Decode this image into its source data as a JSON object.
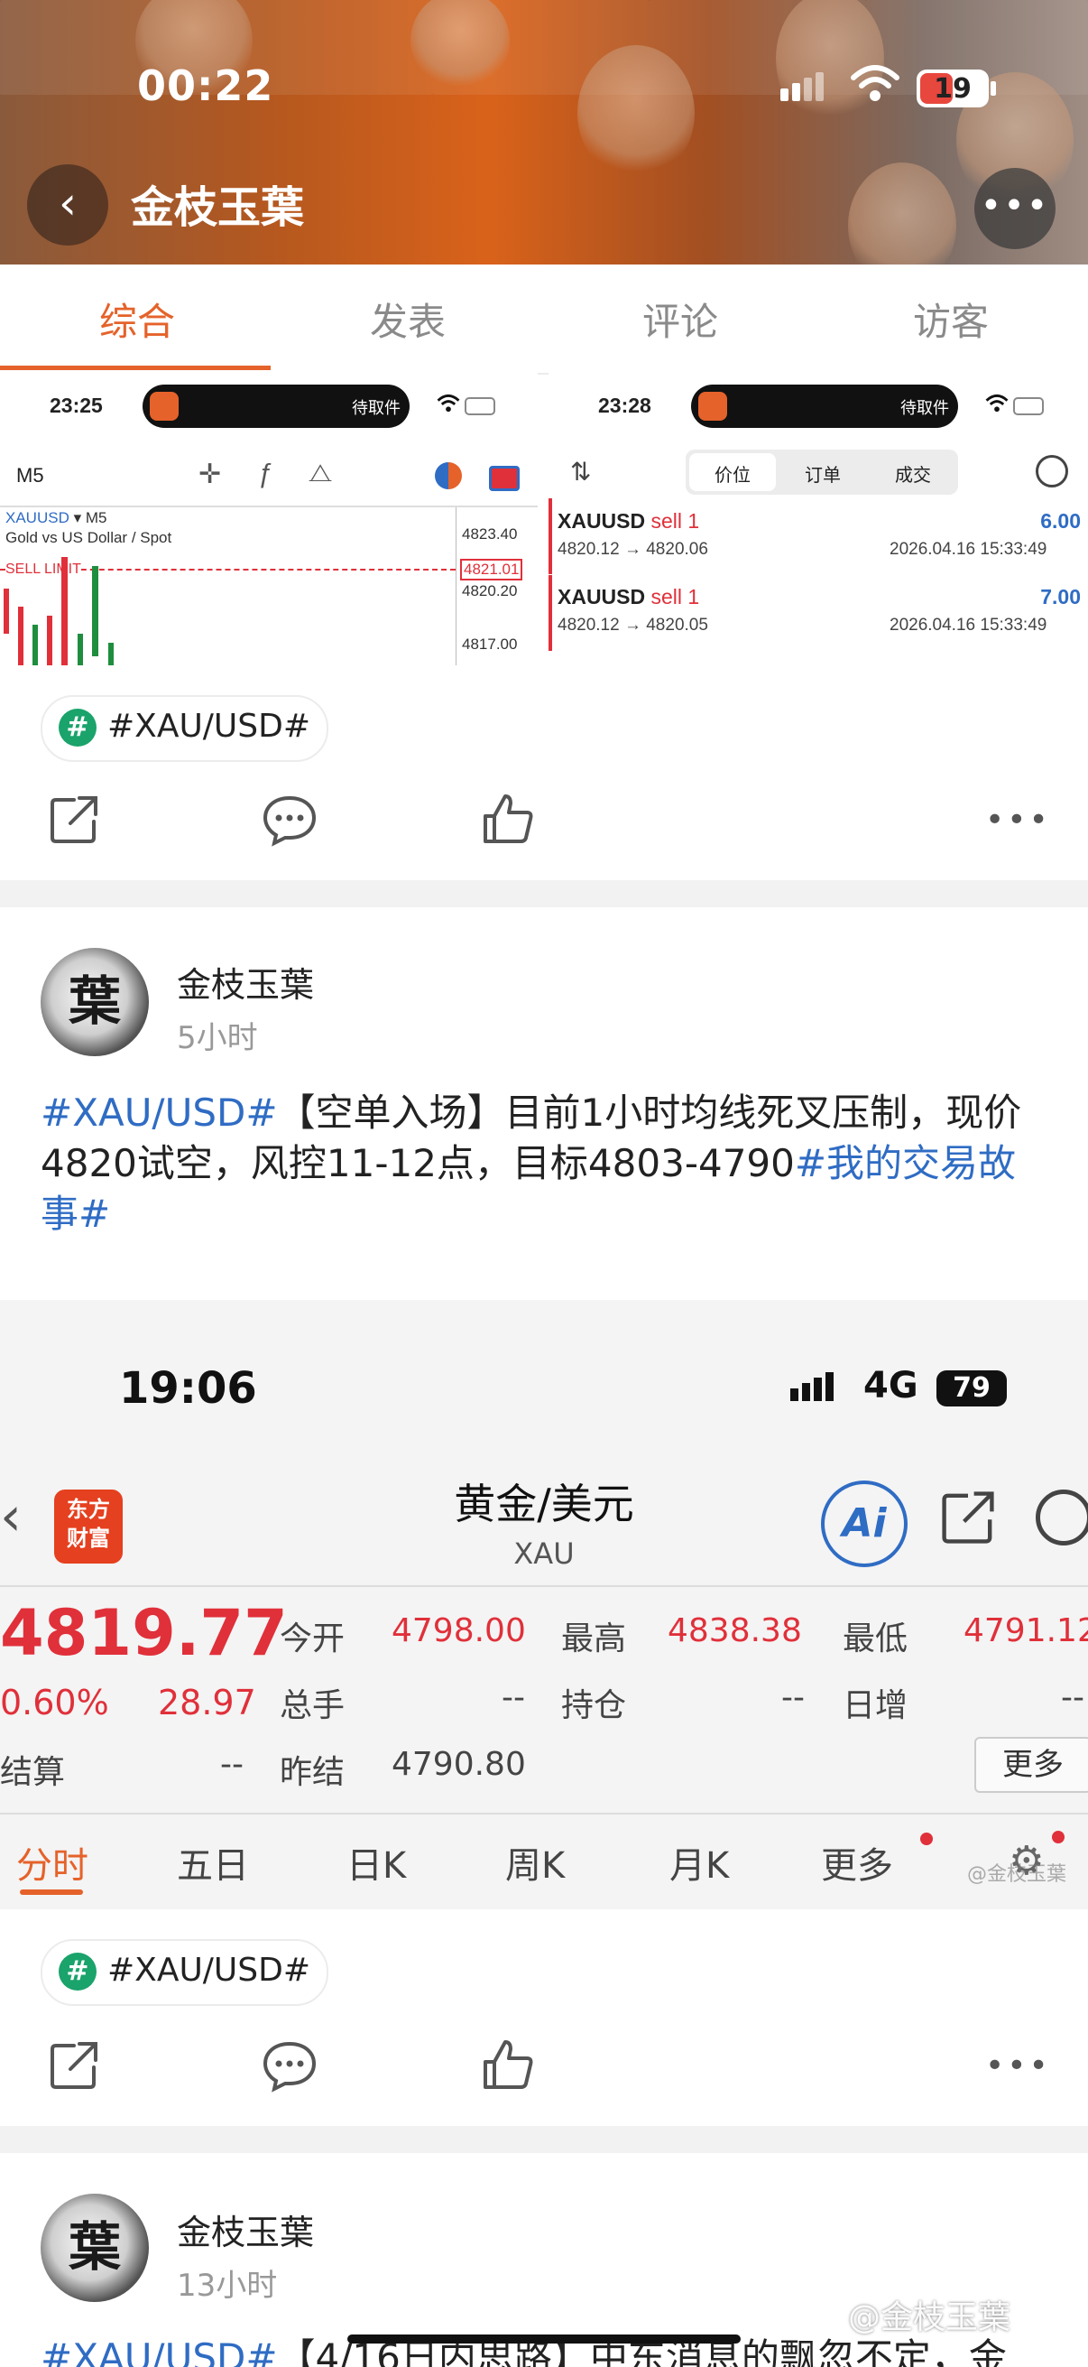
{
  "status_bar": {
    "time": "00:22",
    "battery": "19"
  },
  "header": {
    "title": "金枝玉葉"
  },
  "tabs": [
    "综合",
    "发表",
    "评论",
    "访客"
  ],
  "post1": {
    "left_shot": {
      "time": "23:25",
      "pill_label": "待取件",
      "timeframe": "M5",
      "symbol": "XAUUSD",
      "sym_tf": "▾ M5",
      "desc": "Gold vs US Dollar / Spot",
      "sell_limit": "SELL LIMIT",
      "prices": [
        "4823.40",
        "4821.01",
        "4820.20",
        "4817.00"
      ]
    },
    "right_shot": {
      "time": "23:28",
      "pill_label": "待取件",
      "tabs": [
        "价位",
        "订单",
        "成交"
      ],
      "orders": [
        {
          "symbol": "XAUUSD",
          "side": "sell 1",
          "route": "4820.12 → 4820.06",
          "profit": "6.00",
          "datetime": "2026.04.16 15:33:49"
        },
        {
          "symbol": "XAUUSD",
          "side": "sell 1",
          "route": "4820.12 → 4820.05",
          "profit": "7.00",
          "datetime": "2026.04.16 15:33:49"
        }
      ]
    },
    "hashtag": "#XAU/USD#"
  },
  "post2": {
    "author": "金枝玉葉",
    "avatar_char": "葉",
    "time": "5小时",
    "text_tag1": "#XAU/USD#",
    "text_main": "【空单入场】目前1小时均线死叉压制，现价4820试空，风控11-12点，目标4803-4790",
    "text_tag2": "#我的交易故事#",
    "shot": {
      "time": "19:06",
      "network": "4G",
      "battery": "79",
      "app_logo": "东方\n财富",
      "title": "黄金/美元",
      "subtitle": "XAU",
      "ai_label": "Ai",
      "price": "4819.77",
      "pct": "0.60%",
      "chg": "28.97",
      "stats": [
        {
          "label": "今开",
          "value": "4798.00"
        },
        {
          "label": "最高",
          "value": "4838.38"
        },
        {
          "label": "最低",
          "value": "4791.12"
        },
        {
          "label": "总手",
          "value": "--"
        },
        {
          "label": "持仓",
          "value": "--"
        },
        {
          "label": "日增",
          "value": "--"
        },
        {
          "label": "结算",
          "value": "--"
        },
        {
          "label": "昨结",
          "value": "4790.80"
        }
      ],
      "more_btn": "更多",
      "chart_tabs": [
        "分时",
        "五日",
        "日K",
        "周K",
        "月K",
        "更多"
      ],
      "watermark": "@金枝玉葉"
    },
    "hashtag": "#XAU/USD#"
  },
  "post3": {
    "author": "金枝玉葉",
    "avatar_char": "葉",
    "time": "13小时",
    "text_tag1": "#XAU/USD#",
    "text_main": "【4/16日内思路】中东消息的飘忽不定，金",
    "watermark": "@金枝玉葉"
  },
  "colors": {
    "accent": "#e5622a",
    "tag_blue": "#2f6cc4",
    "up_red": "#e0303a",
    "hash_green": "#1aa36b"
  }
}
